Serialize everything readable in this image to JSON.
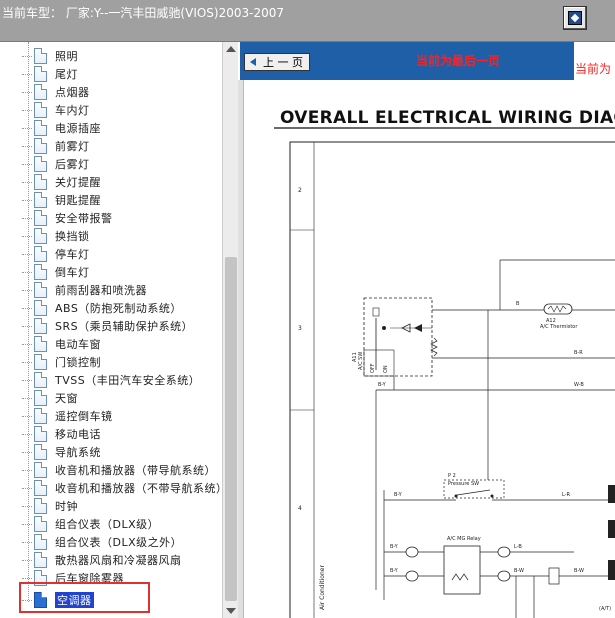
{
  "header": {
    "title": "当前车型： 厂家:Y--一汽丰田威驰(VIOS)2003-2007"
  },
  "tree": {
    "items": [
      {
        "label": "照明"
      },
      {
        "label": "尾灯"
      },
      {
        "label": "点烟器"
      },
      {
        "label": "车内灯"
      },
      {
        "label": "电源插座"
      },
      {
        "label": "前雾灯"
      },
      {
        "label": "后雾灯"
      },
      {
        "label": "关灯提醒"
      },
      {
        "label": "钥匙提醒"
      },
      {
        "label": "安全带报警"
      },
      {
        "label": "换挡锁"
      },
      {
        "label": "停车灯"
      },
      {
        "label": "倒车灯"
      },
      {
        "label": "前雨刮器和喷洗器"
      },
      {
        "label": "ABS（防抱死制动系统）"
      },
      {
        "label": "SRS（乘员辅助保护系统）"
      },
      {
        "label": "电动车窗"
      },
      {
        "label": "门锁控制"
      },
      {
        "label": "TVSS（丰田汽车安全系统）"
      },
      {
        "label": "天窗"
      },
      {
        "label": "遥控倒车镜"
      },
      {
        "label": "移动电话"
      },
      {
        "label": "导航系统"
      },
      {
        "label": "收音机和播放器（带导航系统）"
      },
      {
        "label": "收音机和播放器（不带导航系统）"
      },
      {
        "label": "时钟"
      },
      {
        "label": "组合仪表（DLX级）"
      },
      {
        "label": "组合仪表（DLX级之外）"
      },
      {
        "label": "散热器风扇和冷凝器风扇"
      },
      {
        "label": "后车窗除雾器"
      },
      {
        "label": "空调器"
      }
    ],
    "selected_label": "空调器"
  },
  "viewer": {
    "prev_label": "上 一 页",
    "status_last_page": "当前为最后一页",
    "status_right": "当前为"
  },
  "diagram": {
    "title": "OVERALL ELECTRICAL WIRING DIAGR",
    "labels": {
      "a11": "A11",
      "ac_sw": "A/C SW",
      "off": "OFF",
      "on": "ON",
      "a12": "A12",
      "ac_thermistor": "A/C Thermistor",
      "p2": "P 2",
      "pressure_sw": "Pressure SW",
      "ac_mg_relay": "A/C MG Relay",
      "air_conditioner": "Air Conditioner",
      "row2": "2",
      "row3": "3",
      "row4": "4",
      "w_b": "W-B",
      "b_r": "B-R",
      "b_y": "B-Y",
      "l_r": "L-R",
      "l_b": "L-B",
      "b_w": "B-W",
      "b": "B",
      "w": "W",
      "ac": "(A/T)"
    }
  },
  "colors": {
    "header_bg": "#a0a0a0",
    "nav_blue": "#1f5fa8",
    "status_red": "#ff2020",
    "selection_blue": "#2244cc",
    "highlight_red": "#e03030"
  }
}
